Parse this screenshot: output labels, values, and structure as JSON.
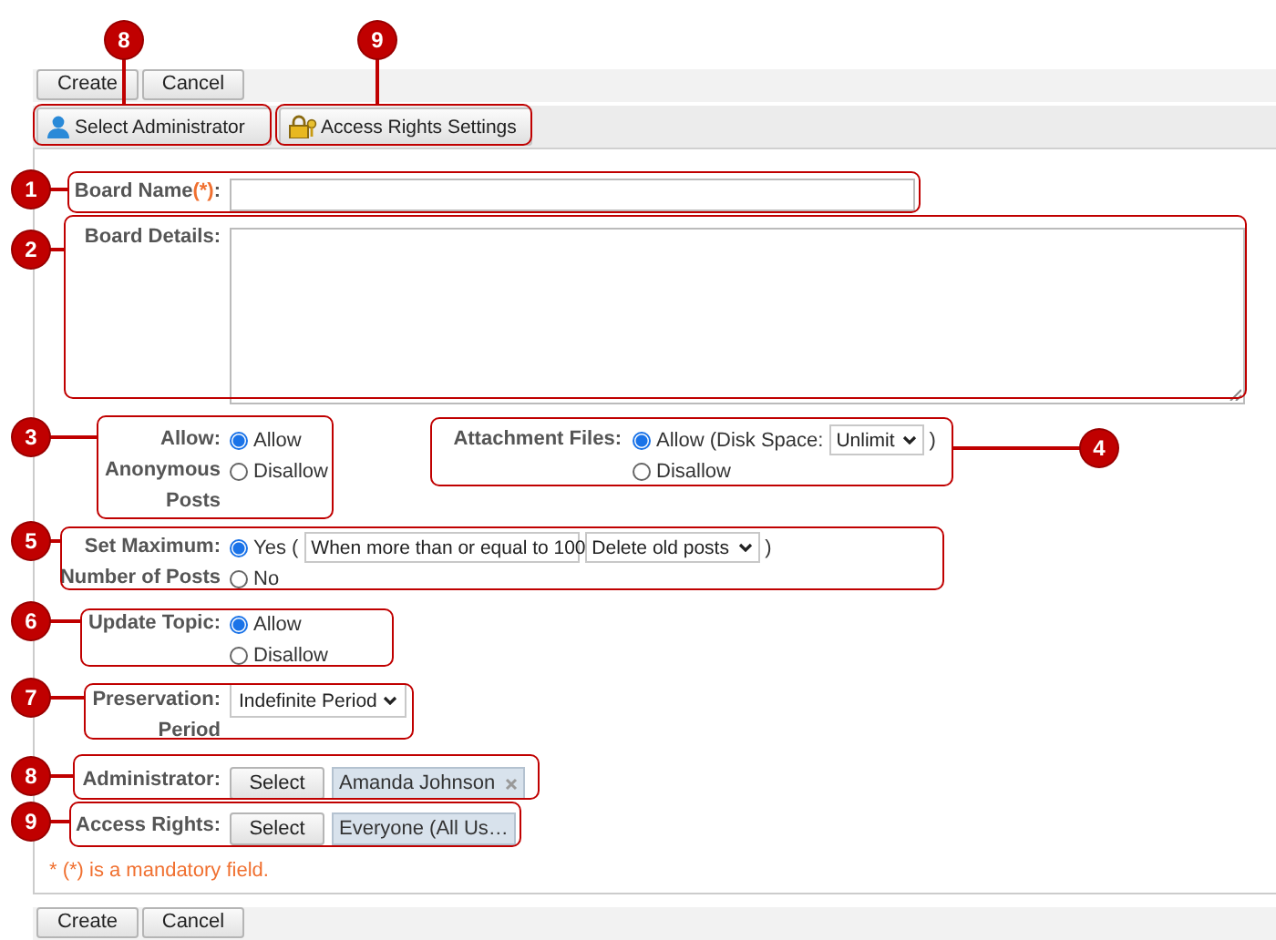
{
  "top_buttons": [
    "Create",
    "Cancel"
  ],
  "tabs": [
    {
      "label": "Select Administrator"
    },
    {
      "label": "Access Rights Settings"
    }
  ],
  "rows": [
    {
      "kind": "text",
      "label": [
        "Board Name"
      ],
      "required_mark": "(*)",
      "label_end": ":"
    },
    {
      "kind": "textarea",
      "label": [
        "Board Details:"
      ]
    },
    {
      "kind": "radio",
      "label": [
        "Allow:",
        "Anonymous",
        "Posts"
      ],
      "options": [
        {
          "label": "Allow",
          "selected": true
        },
        {
          "label": "Disallow",
          "selected": false
        }
      ],
      "aside": {
        "label": [
          "Attachment Files:"
        ],
        "options": [
          {
            "label": "Allow (Disk Space:",
            "selected": true,
            "selects": [
              "Unlimit"
            ],
            "after": ")"
          },
          {
            "label": "Disallow",
            "selected": false
          }
        ]
      }
    },
    {
      "kind": "radio",
      "label": [
        "Set Maximum:",
        "Number of Posts"
      ],
      "options": [
        {
          "label": "Yes (",
          "selected": true,
          "selects": [
            "When more than or equal to 100",
            "Delete old posts"
          ],
          "after": ")"
        },
        {
          "label": "No",
          "selected": false
        }
      ]
    },
    {
      "kind": "radio",
      "label": [
        "Update Topic:"
      ],
      "options": [
        {
          "label": "Allow",
          "selected": true
        },
        {
          "label": "Disallow",
          "selected": false
        }
      ]
    },
    {
      "kind": "select",
      "label": [
        "Preservation:",
        "Period"
      ],
      "value": "Indefinite Period"
    },
    {
      "kind": "picker",
      "label": [
        "Administrator:"
      ],
      "button": "Select",
      "value": "Amanda Johnson",
      "removable": true
    },
    {
      "kind": "picker",
      "label": [
        "Access Rights:"
      ],
      "button": "Select",
      "value": "Everyone (All Us…",
      "removable": false
    }
  ],
  "note": "* (*) is a mandatory field.",
  "bottom_buttons": [
    "Create",
    "Cancel"
  ],
  "callouts": [
    {
      "number": "8"
    },
    {
      "number": "9"
    },
    {
      "number": "1"
    },
    {
      "number": "2"
    },
    {
      "number": "3"
    },
    {
      "number": "4"
    },
    {
      "number": "5"
    },
    {
      "number": "6"
    },
    {
      "number": "7"
    },
    {
      "number": "8"
    },
    {
      "number": "9"
    }
  ]
}
